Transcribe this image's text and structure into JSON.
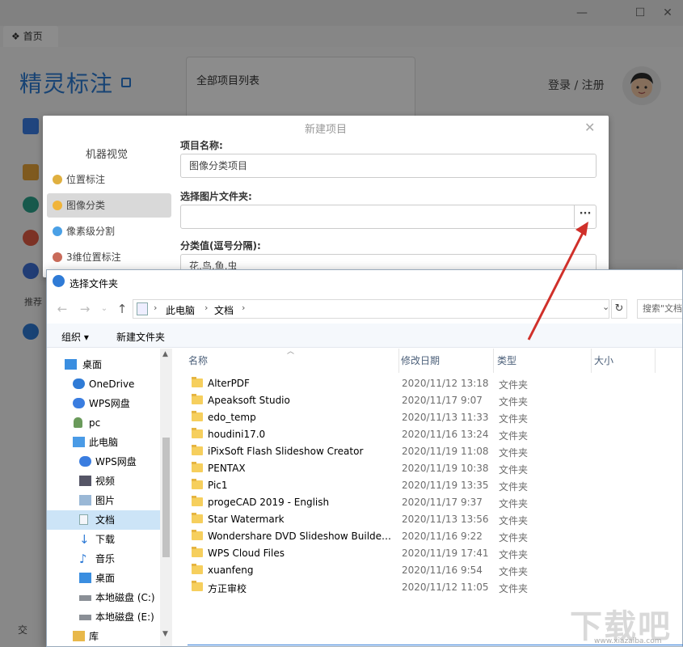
{
  "app": {
    "home_tab": "首页",
    "brand": "精灵标注",
    "project_list_title": "全部项目列表",
    "login": "登录 / 注册",
    "side_text": "推荐",
    "bottom_text": "交"
  },
  "new_project_dialog": {
    "title": "新建项目",
    "category_heading": "机器视觉",
    "categories": [
      {
        "label": "位置标注"
      },
      {
        "label": "图像分类"
      },
      {
        "label": "像素级分割"
      },
      {
        "label": "3维位置标注"
      }
    ],
    "selected_category": "图像分类",
    "project_name_label": "项目名称:",
    "project_name_value": "图像分类项目",
    "folder_label": "选择图片文件夹:",
    "folder_value": "",
    "browse_label": "···",
    "class_values_label": "分类值(逗号分隔):",
    "class_values_value": "花,鸟,鱼,虫"
  },
  "folder_dialog": {
    "title": "选择文件夹",
    "breadcrumb": [
      "此电脑",
      "文档"
    ],
    "search_placeholder": "搜索\"文档\"",
    "toolbar": {
      "organize": "组织 ▾",
      "new_folder": "新建文件夹"
    },
    "nav_tree": [
      {
        "label": "桌面",
        "icon": "desktop-icon"
      },
      {
        "label": "OneDrive",
        "icon": "cloud-icon"
      },
      {
        "label": "WPS网盘",
        "icon": "cloud-icon"
      },
      {
        "label": "pc",
        "icon": "user-icon"
      },
      {
        "label": "此电脑",
        "icon": "computer-icon"
      },
      {
        "label": "WPS网盘",
        "icon": "cloud-icon"
      },
      {
        "label": "视频",
        "icon": "video-icon"
      },
      {
        "label": "图片",
        "icon": "picture-icon"
      },
      {
        "label": "文档",
        "icon": "document-icon"
      },
      {
        "label": "下载",
        "icon": "download-icon"
      },
      {
        "label": "音乐",
        "icon": "music-icon"
      },
      {
        "label": "桌面",
        "icon": "desktop-icon"
      },
      {
        "label": "本地磁盘 (C:)",
        "icon": "drive-icon"
      },
      {
        "label": "本地磁盘 (E:)",
        "icon": "drive-icon"
      },
      {
        "label": "库",
        "icon": "library-icon"
      }
    ],
    "columns": [
      "名称",
      "修改日期",
      "类型",
      "大小"
    ],
    "files": [
      {
        "name": "AlterPDF",
        "date": "2020/11/12 13:18",
        "type": "文件夹"
      },
      {
        "name": "Apeaksoft Studio",
        "date": "2020/11/17 9:07",
        "type": "文件夹"
      },
      {
        "name": "edo_temp",
        "date": "2020/11/13 11:33",
        "type": "文件夹"
      },
      {
        "name": "houdini17.0",
        "date": "2020/11/16 13:24",
        "type": "文件夹"
      },
      {
        "name": "iPixSoft Flash Slideshow Creator",
        "date": "2020/11/19 11:08",
        "type": "文件夹"
      },
      {
        "name": "PENTAX",
        "date": "2020/11/19 10:38",
        "type": "文件夹"
      },
      {
        "name": "Pic1",
        "date": "2020/11/19 13:35",
        "type": "文件夹"
      },
      {
        "name": "progeCAD 2019 - English",
        "date": "2020/11/17 9:37",
        "type": "文件夹"
      },
      {
        "name": "Star Watermark",
        "date": "2020/11/13 13:56",
        "type": "文件夹"
      },
      {
        "name": "Wondershare DVD Slideshow Builder...",
        "date": "2020/11/16 9:22",
        "type": "文件夹"
      },
      {
        "name": "WPS Cloud Files",
        "date": "2020/11/19 17:41",
        "type": "文件夹"
      },
      {
        "name": "xuanfeng",
        "date": "2020/11/16 9:54",
        "type": "文件夹"
      },
      {
        "name": "方正审校",
        "date": "2020/11/12 11:05",
        "type": "文件夹"
      }
    ]
  },
  "watermark": {
    "text": "下载吧",
    "url": "www.xiazaiba.com"
  },
  "colors": {
    "brand": "#2a7ad4",
    "annotation_arrow": "#d0302a",
    "selection": "#cce4f7",
    "folder": "#f6cf5d"
  }
}
